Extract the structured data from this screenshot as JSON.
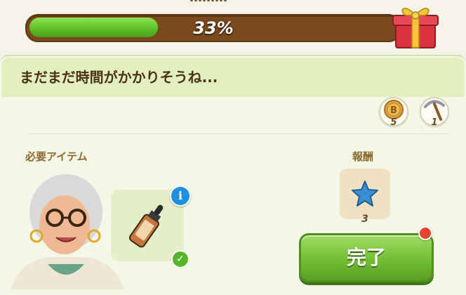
{
  "top": {
    "title": "………",
    "progress_percent": 33,
    "progress_label": "33%"
  },
  "message": "まだまだ時間がかかりそうね...",
  "costs": [
    {
      "icon": "coin-icon",
      "count": "5"
    },
    {
      "icon": "pickaxe-icon",
      "count": "1"
    }
  ],
  "required_items": {
    "label": "必要アイテム",
    "item_icon": "dropper-bottle-icon"
  },
  "reward": {
    "label": "報酬",
    "icon": "blue-star-icon",
    "count": "3"
  },
  "done_button": {
    "label": "完了"
  },
  "colors": {
    "progress_fill": "#5ec126",
    "progress_track": "#7a4a1e",
    "button_green": "#72be33",
    "notification": "#e8412f",
    "info_blue": "#1f8fe0"
  }
}
